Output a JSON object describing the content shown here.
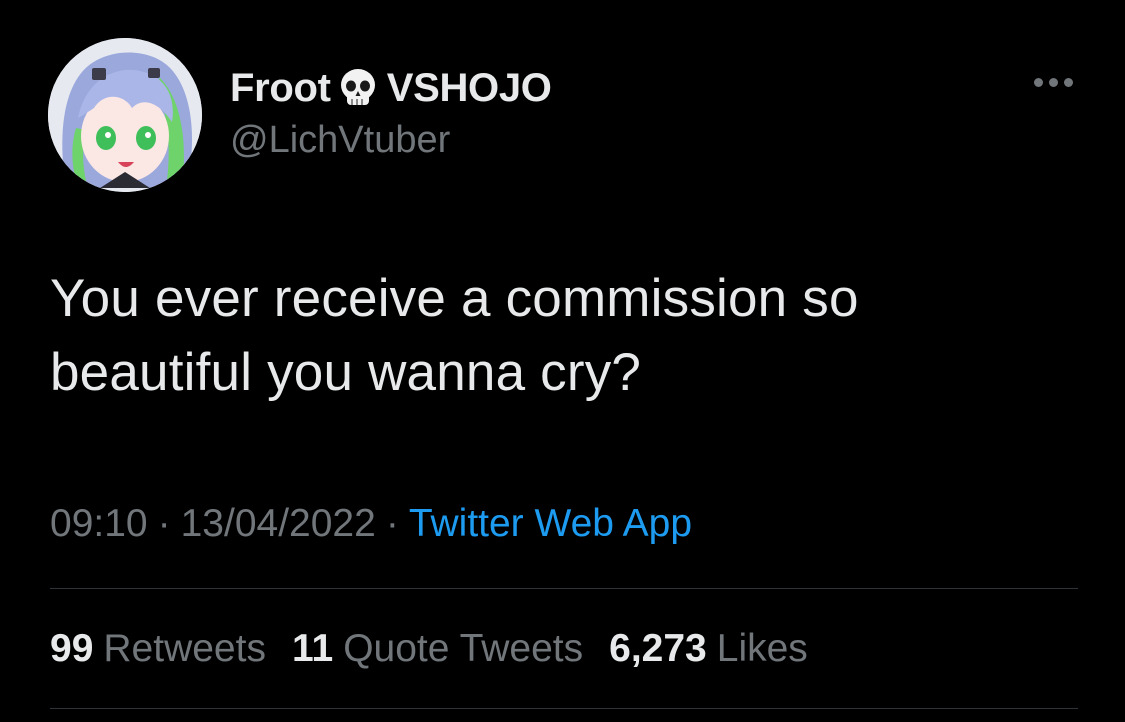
{
  "user": {
    "display_name_part1": "Froot",
    "display_name_emoji": "skull-emoji",
    "display_name_part2": "VSHOJO",
    "handle": "@LichVtuber"
  },
  "more_icon": "more-horizontal-icon",
  "tweet": {
    "text_line1": "You ever receive a commission so",
    "text_line2": "beautiful you wanna cry?",
    "time": "09:10",
    "date": "13/04/2022",
    "separator": "·",
    "source": "Twitter Web App"
  },
  "stats": {
    "retweets_count": "99",
    "retweets_label": "Retweets",
    "quotes_count": "11",
    "quotes_label": "Quote Tweets",
    "likes_count": "6,273",
    "likes_label": "Likes"
  },
  "colors": {
    "background": "#000000",
    "primary_text": "#e7e9ea",
    "secondary_text": "#71767b",
    "link": "#1d9bf0",
    "divider": "#2f3336"
  }
}
